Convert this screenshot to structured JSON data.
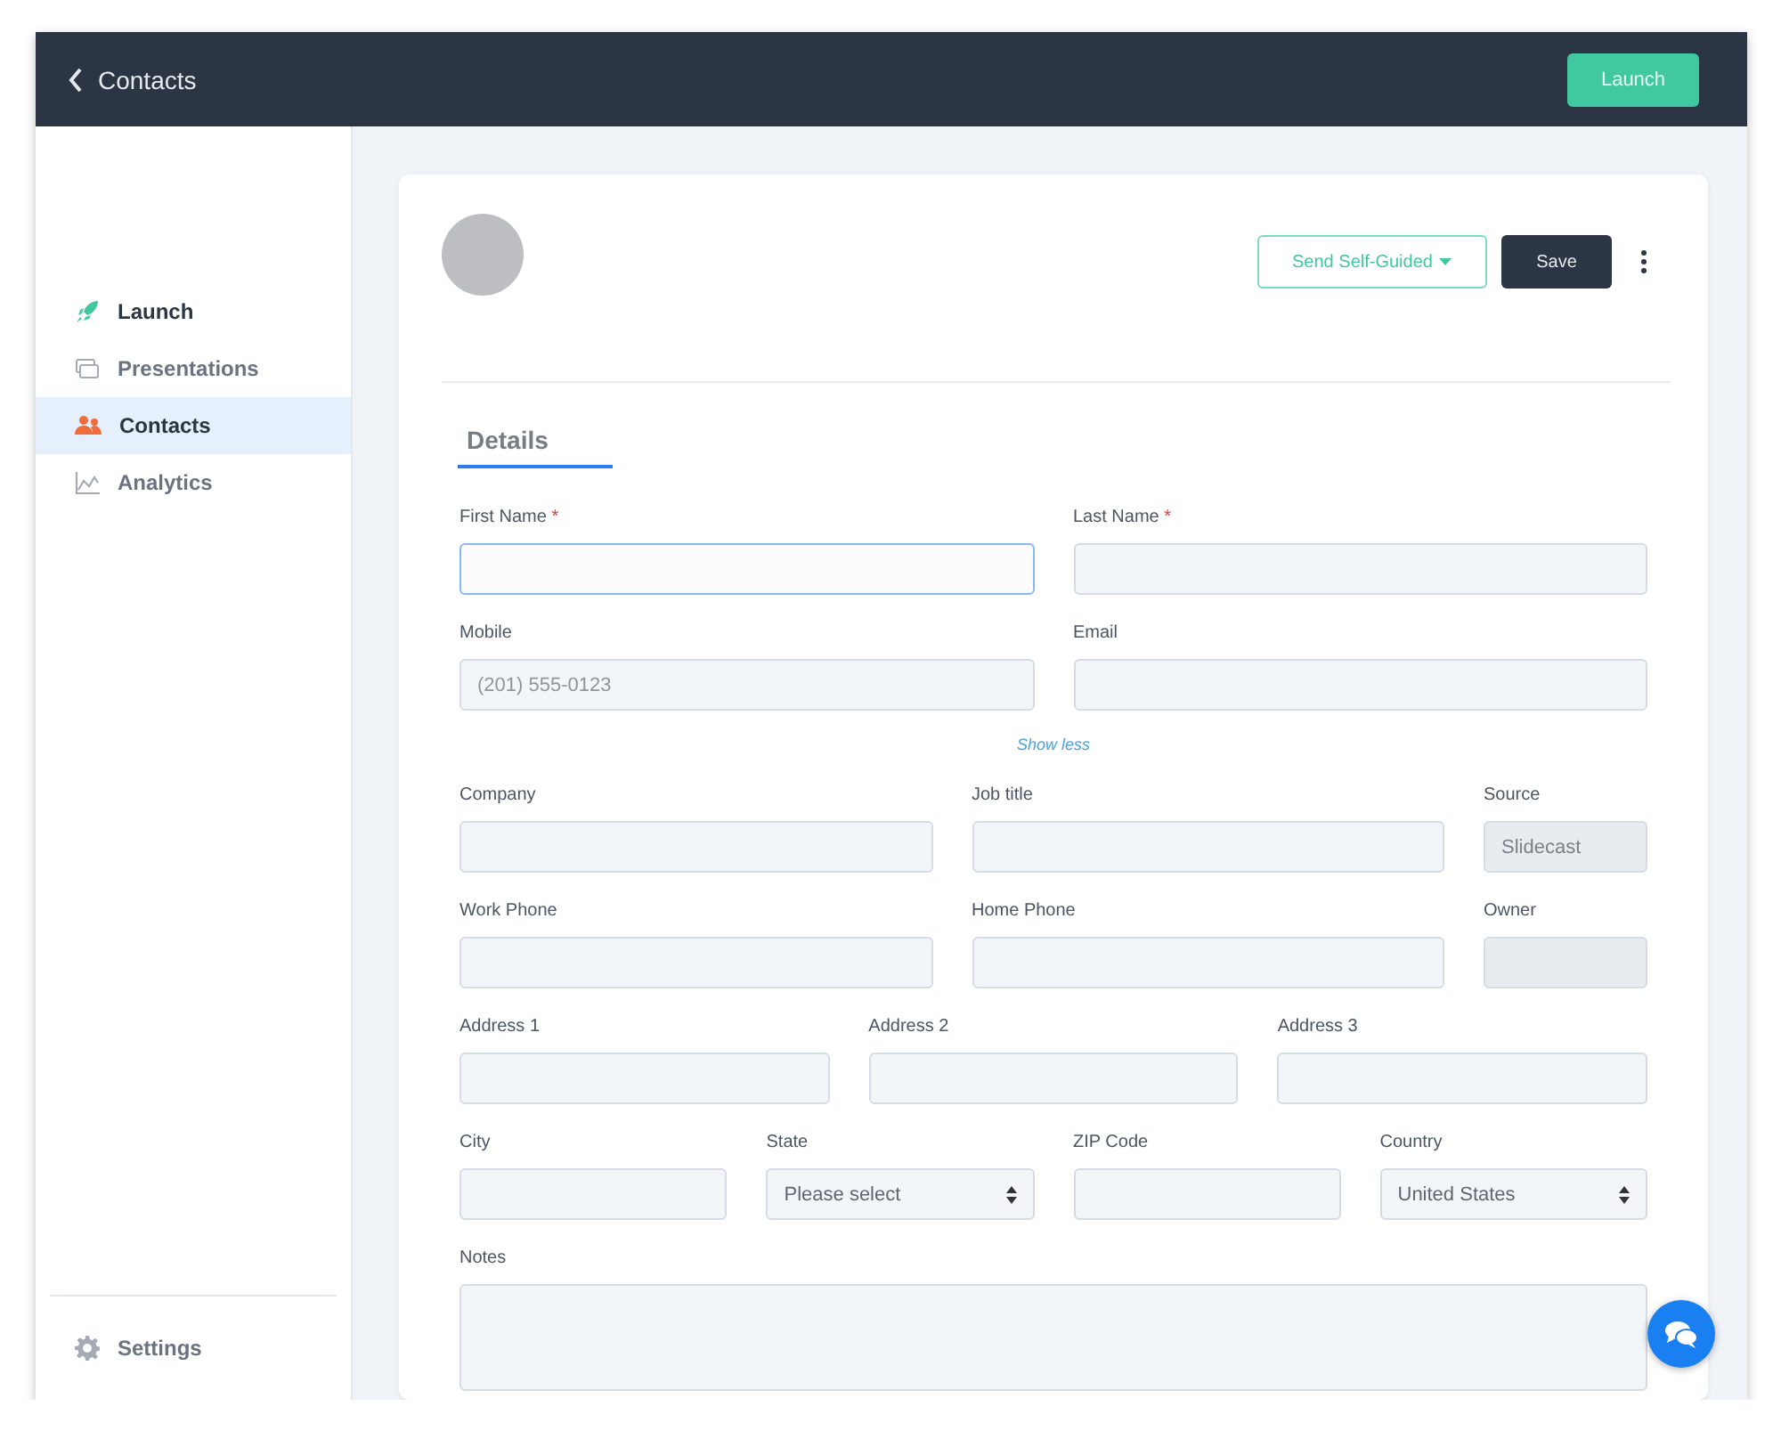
{
  "header": {
    "back_label": "Contacts",
    "launch_button": "Launch"
  },
  "sidebar": {
    "items": [
      {
        "label": "Launch",
        "kind": "rocket",
        "selected": false
      },
      {
        "label": "Presentations",
        "kind": "slides",
        "selected": false
      },
      {
        "label": "Contacts",
        "kind": "people",
        "selected": true
      },
      {
        "label": "Analytics",
        "kind": "chart",
        "selected": false
      }
    ],
    "settings": "Settings"
  },
  "card": {
    "send_button": "Send Self-Guided",
    "save_button": "Save",
    "tabs": [
      {
        "label": "Details",
        "selected": true
      }
    ],
    "show_less": "Show less",
    "required_mark": "*",
    "rows": [
      {
        "fields": [
          {
            "label": "First Name",
            "kind": "text",
            "required": true,
            "focused": true
          },
          {
            "label": "Last Name",
            "kind": "text",
            "required": true,
            "focused": false
          }
        ]
      },
      {
        "fields": [
          {
            "label": "Mobile",
            "kind": "text",
            "required": false,
            "focused": false,
            "placeholder": "(201) 555-0123"
          },
          {
            "label": "Email",
            "kind": "text",
            "required": false,
            "focused": false
          }
        ]
      },
      {
        "fields": [
          {
            "label": "Company",
            "kind": "text",
            "required": false,
            "focused": false
          },
          {
            "label": "Job title",
            "kind": "text",
            "required": false,
            "focused": false
          },
          {
            "label": "Source",
            "kind": "readonly",
            "required": false,
            "focused": false,
            "value": "Slidecast"
          }
        ]
      },
      {
        "fields": [
          {
            "label": "Work Phone",
            "kind": "text",
            "required": false,
            "focused": false
          },
          {
            "label": "Home Phone",
            "kind": "text",
            "required": false,
            "focused": false
          },
          {
            "label": "Owner",
            "kind": "readonly",
            "required": false,
            "focused": false
          }
        ]
      },
      {
        "fields": [
          {
            "label": "Address 1",
            "kind": "text",
            "required": false,
            "focused": false
          },
          {
            "label": "Address 2",
            "kind": "text",
            "required": false,
            "focused": false
          },
          {
            "label": "Address 3",
            "kind": "text",
            "required": false,
            "focused": false
          }
        ]
      },
      {
        "fields": [
          {
            "label": "City",
            "kind": "text",
            "required": false,
            "focused": false
          },
          {
            "label": "State",
            "kind": "select",
            "required": false,
            "focused": false,
            "value": "Please select"
          },
          {
            "label": "ZIP Code",
            "kind": "text",
            "required": false,
            "focused": false
          },
          {
            "label": "Country",
            "kind": "select",
            "required": false,
            "focused": false,
            "value": "United States"
          }
        ]
      }
    ],
    "notes_label": "Notes"
  }
}
